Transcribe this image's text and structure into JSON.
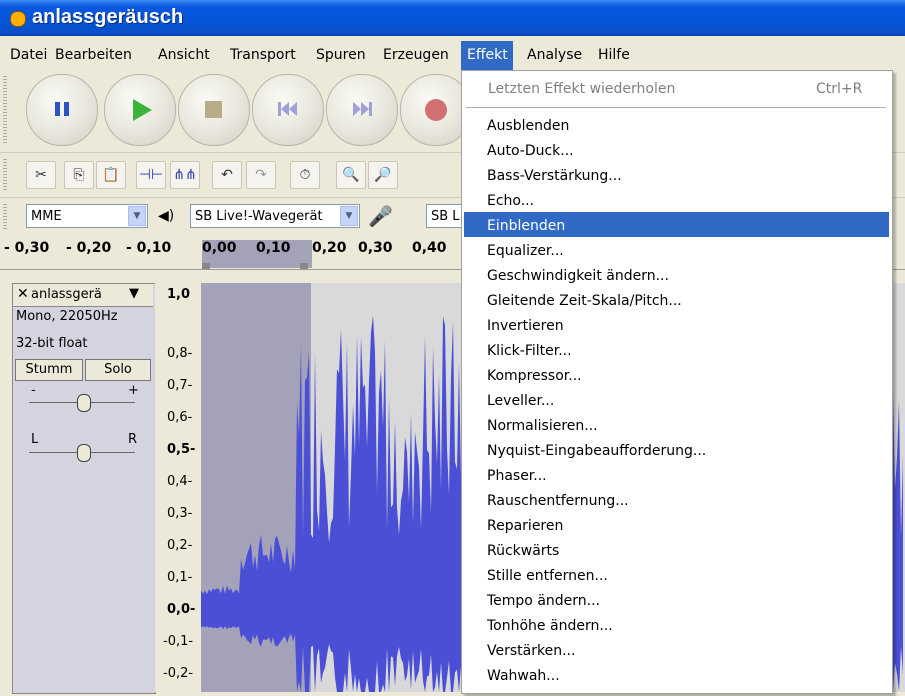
{
  "window": {
    "title": "anlassgeräusch"
  },
  "menubar": [
    "Datei",
    "Bearbeiten",
    "Ansicht",
    "Transport",
    "Spuren",
    "Erzeugen",
    "Effekt",
    "Analyse",
    "Hilfe"
  ],
  "active_menu": "Effekt",
  "toolbar": {
    "icons": [
      "pause-icon",
      "play-icon",
      "stop-icon",
      "skip-start-icon",
      "skip-end-icon",
      "record-icon"
    ],
    "edit_icons": [
      "cut-icon",
      "copy-icon",
      "paste-icon",
      "trim-icon",
      "silence-icon",
      "undo-icon",
      "redo-icon",
      "timer-icon",
      "zoom-in-icon",
      "zoom-out-icon"
    ]
  },
  "device": {
    "host": "MME",
    "output_device": "SB Live!-Wavegerät",
    "input_device_partial": "SB L"
  },
  "ruler": {
    "ticks": [
      "- 0,30",
      "- 0,20",
      "- 0,10",
      "0,00",
      "0,10",
      "0,20",
      "0,30",
      "0,40"
    ]
  },
  "track": {
    "name": "anlassgerä",
    "format": "Mono, 22050Hz",
    "bitdepth": "32-bit float",
    "mute": "Stumm",
    "solo": "Solo",
    "gain_minus": "-",
    "gain_plus": "+",
    "pan_left": "L",
    "pan_right": "R"
  },
  "vruler": [
    "1,0",
    "0,8-",
    "0,7-",
    "0,6-",
    "0,5-",
    "0,4-",
    "0,3-",
    "0,2-",
    "0,1-",
    "0,0-",
    "-0,1-",
    "-0,2-"
  ],
  "effekt_menu": {
    "repeat": {
      "label": "Letzten Effekt wiederholen",
      "shortcut": "Ctrl+R"
    },
    "items": [
      "Ausblenden",
      "Auto-Duck...",
      "Bass-Verstärkung...",
      "Echo...",
      "Einblenden",
      "Equalizer...",
      "Geschwindigkeit ändern...",
      "Gleitende Zeit-Skala/Pitch...",
      "Invertieren",
      "Klick-Filter...",
      "Kompressor...",
      "Leveller...",
      "Normalisieren...",
      "Nyquist-Eingabeaufforderung...",
      "Phaser...",
      "Rauschentfernung...",
      "Reparieren",
      "Rückwärts",
      "Stille entfernen...",
      "Tempo ändern...",
      "Tonhöhe ändern...",
      "Verstärken...",
      "Wahwah..."
    ],
    "highlighted": "Einblenden"
  },
  "colors": {
    "title_blue": "#0654d8",
    "highlight": "#316ac5",
    "waveform": "#4a4fd6",
    "selection": "#a3a2b8"
  }
}
